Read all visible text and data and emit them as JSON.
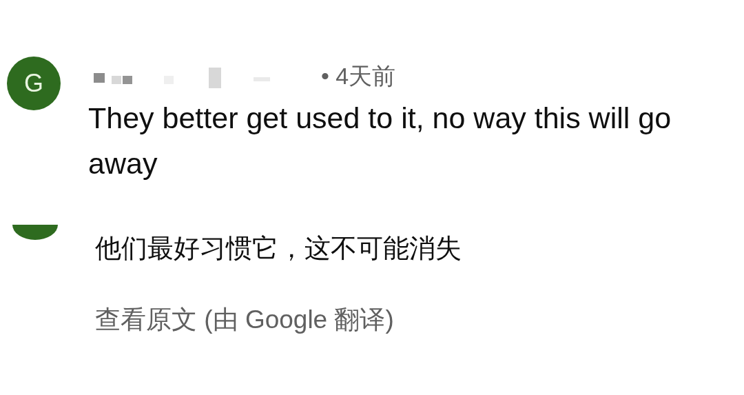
{
  "comment": {
    "avatar_letter": "G",
    "time": "• 4天前",
    "text": "They better get used to it, no way this will go away"
  },
  "translation": {
    "text": "他们最好习惯它，这不可能消失",
    "link": "查看原文 (由 Google 翻译)"
  }
}
